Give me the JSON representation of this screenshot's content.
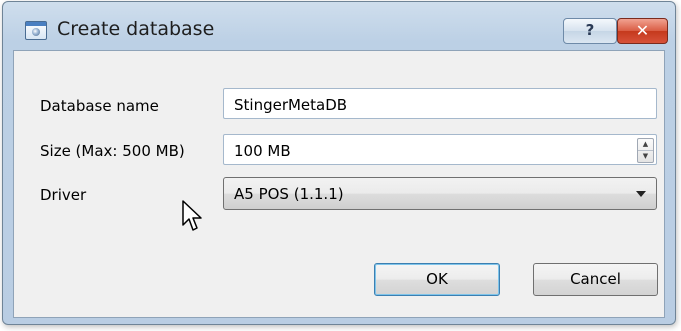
{
  "window": {
    "title": "Create database",
    "help_label": "?",
    "close_label": "✕"
  },
  "form": {
    "name_label": "Database name",
    "name_value": "StingerMetaDB",
    "size_label": "Size (Max: 500 MB)",
    "size_value": "100 MB",
    "driver_label": "Driver",
    "driver_value": "A5 POS (1.1.1)"
  },
  "buttons": {
    "ok_label": "OK",
    "cancel_label": "Cancel"
  },
  "icons": {
    "app": "database-icon",
    "spin_up": "spin-up-arrow-icon",
    "spin_down": "spin-down-arrow-icon",
    "dropdown": "chevron-down-icon",
    "cursor": "mouse-pointer-icon"
  },
  "colors": {
    "title_bar": "#bcd0e5",
    "close_button": "#c5391d",
    "dialog_body": "#f0f0f0",
    "default_button_border": "#3c7fb1"
  }
}
